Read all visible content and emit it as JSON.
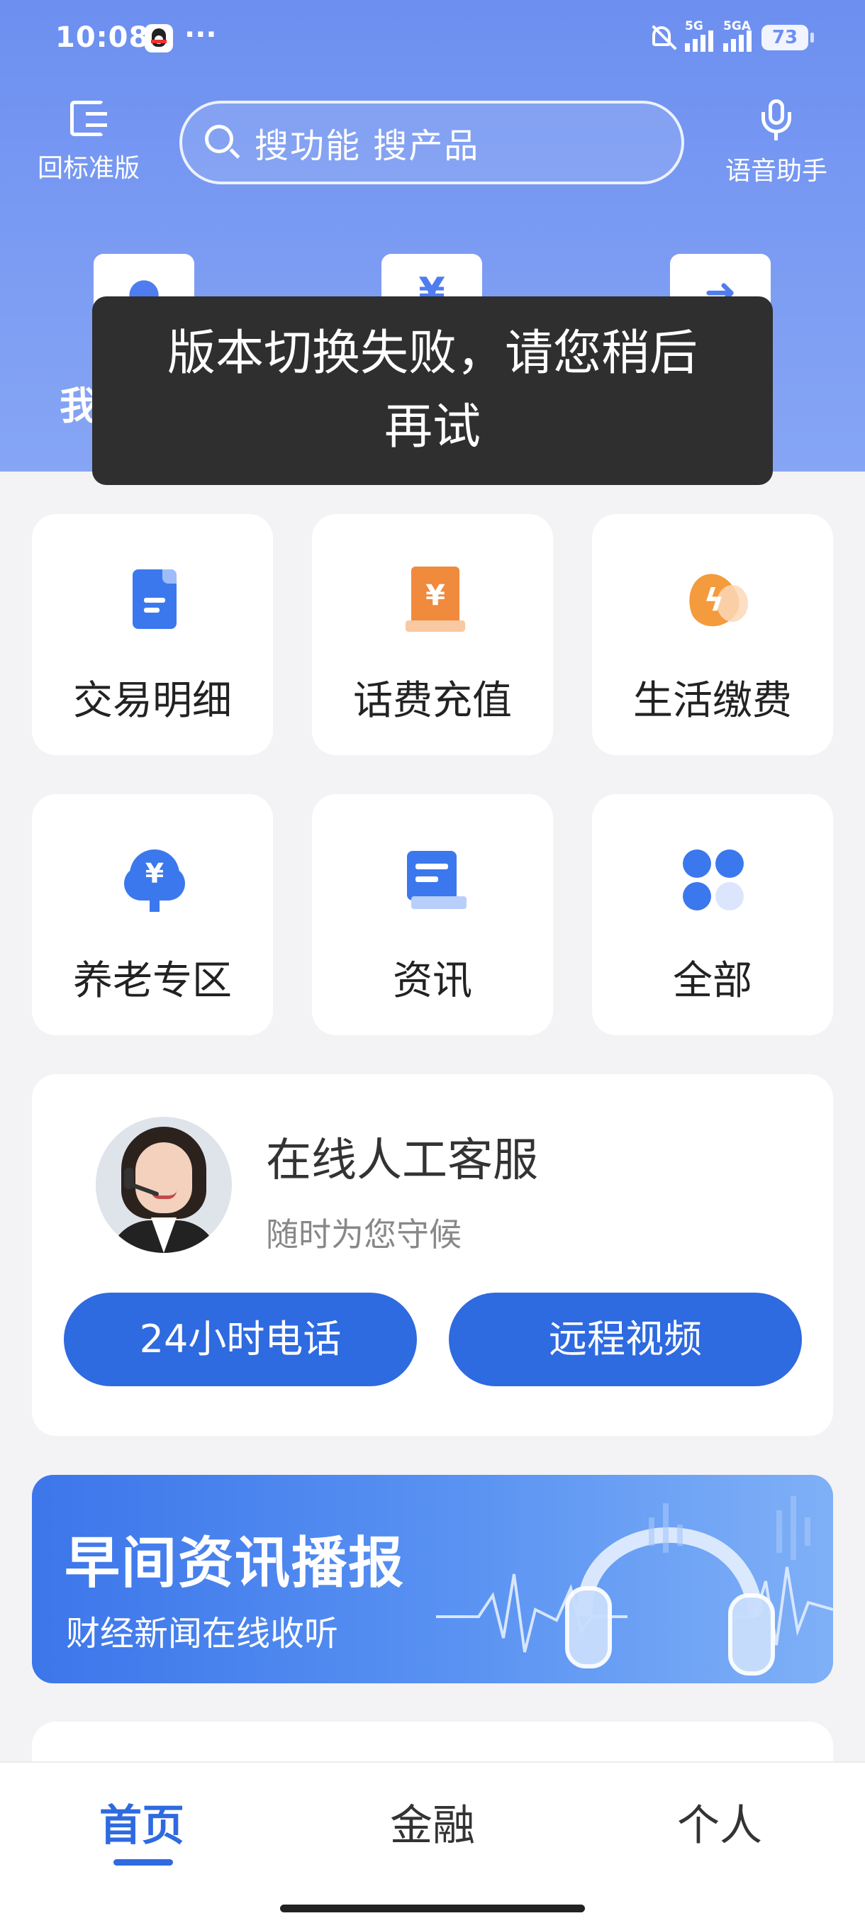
{
  "status_bar": {
    "time": "10:08",
    "more": "···",
    "signal1_tag": "5G",
    "signal2_tag": "5GA",
    "battery": "73"
  },
  "header": {
    "mode_switch_label": "回标准版",
    "search_placeholder": "搜功能 搜产品",
    "voice_label": "语音助手",
    "quick_label_peek": "我"
  },
  "toast": {
    "message": "版本切换失败，请您稍后再试"
  },
  "tiles": [
    {
      "label": "交易明细",
      "icon": "document-icon"
    },
    {
      "label": "话费充值",
      "icon": "bill-icon"
    },
    {
      "label": "生活缴费",
      "icon": "utility-icon"
    },
    {
      "label": "养老专区",
      "icon": "pension-tree-icon"
    },
    {
      "label": "资讯",
      "icon": "news-icon"
    },
    {
      "label": "全部",
      "icon": "all-apps-icon"
    }
  ],
  "service": {
    "title": "在线人工客服",
    "subtitle": "随时为您守候",
    "phone_button": "24小时电话",
    "video_button": "远程视频"
  },
  "banner": {
    "title": "早间资讯播报",
    "subtitle": "财经新闻在线收听"
  },
  "tabbar": {
    "home": "首页",
    "finance": "金融",
    "personal": "个人"
  },
  "colors": {
    "header_blue": "#6c8ff0",
    "accent_blue": "#2e6ae0",
    "toast_bg": "#2f2f2f",
    "page_bg": "#f3f3f5"
  }
}
